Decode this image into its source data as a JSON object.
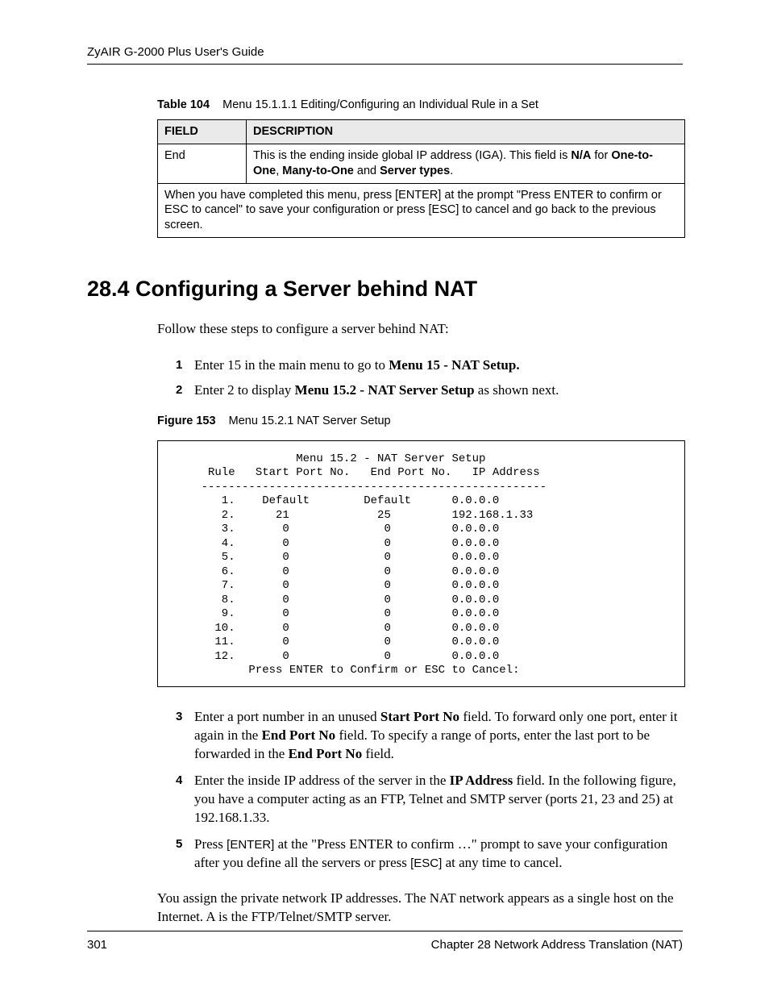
{
  "header": {
    "guide_title": "ZyAIR G-2000 Plus User's Guide"
  },
  "table_caption": {
    "label": "Table 104",
    "text": "Menu 15.1.1.1 Editing/Configuring an Individual Rule in a Set"
  },
  "table": {
    "head_field": "FIELD",
    "head_desc": "DESCRIPTION",
    "row_field": "End",
    "row_desc_pre": "This is the ending inside global IP address (IGA). This field is ",
    "row_desc_b1": "N/A",
    "row_desc_mid": " for ",
    "row_desc_b2": "One-to-One",
    "row_desc_sep": ", ",
    "row_desc_b3": "Many-to-One",
    "row_desc_and": " and ",
    "row_desc_b4": "Server types",
    "row_desc_end": ".",
    "footnote": "When you have completed this menu, press [ENTER] at the prompt \"Press ENTER to confirm or ESC to cancel\" to save your configuration or press [ESC] to cancel and go back to the previous screen."
  },
  "section": {
    "number_title": "28.4  Configuring a Server behind NAT",
    "intro": "Follow these steps to configure a server behind NAT:"
  },
  "steps1": {
    "s1": {
      "n": "1",
      "pre": "Enter 15 in the main menu to go to ",
      "b": "Menu 15 - NAT Setup."
    },
    "s2": {
      "n": "2",
      "pre": "Enter 2 to display ",
      "b": "Menu 15.2 - NAT Server Setup",
      "post": " as shown next."
    }
  },
  "figure_caption": {
    "label": "Figure 153",
    "text": "Menu 15.2.1 NAT Server Setup"
  },
  "menu": {
    "title": "Menu 15.2 - NAT Server Setup",
    "header": "     Rule   Start Port No.   End Port No.   IP Address",
    "divider": "    ---------------------------------------------------",
    "rows": [
      {
        "r": " 1.",
        "s": "Default",
        "e": "Default",
        "ip": "0.0.0.0"
      },
      {
        "r": " 2.",
        "s": "  21",
        "e": "  25",
        "ip": "192.168.1.33"
      },
      {
        "r": " 3.",
        "s": "   0",
        "e": "   0",
        "ip": "0.0.0.0"
      },
      {
        "r": " 4.",
        "s": "   0",
        "e": "   0",
        "ip": "0.0.0.0"
      },
      {
        "r": " 5.",
        "s": "   0",
        "e": "   0",
        "ip": "0.0.0.0"
      },
      {
        "r": " 6.",
        "s": "   0",
        "e": "   0",
        "ip": "0.0.0.0"
      },
      {
        "r": " 7.",
        "s": "   0",
        "e": "   0",
        "ip": "0.0.0.0"
      },
      {
        "r": " 8.",
        "s": "   0",
        "e": "   0",
        "ip": "0.0.0.0"
      },
      {
        "r": " 9.",
        "s": "   0",
        "e": "   0",
        "ip": "0.0.0.0"
      },
      {
        "r": "10.",
        "s": "   0",
        "e": "   0",
        "ip": "0.0.0.0"
      },
      {
        "r": "11.",
        "s": "   0",
        "e": "   0",
        "ip": "0.0.0.0"
      },
      {
        "r": "12.",
        "s": "   0",
        "e": "   0",
        "ip": "0.0.0.0"
      }
    ],
    "prompt": "Press ENTER to Confirm or ESC to Cancel:"
  },
  "steps2": {
    "s3": {
      "n": "3",
      "t1": "Enter a port number in an unused ",
      "b1": "Start Port No",
      "t2": " field. To forward only one port, enter it again in the ",
      "b2": "End Port No",
      "t3": " field. To specify a range of ports, enter the last port to be forwarded in the ",
      "b3": "End Port No",
      "t4": " field."
    },
    "s4": {
      "n": "4",
      "t1": "Enter the inside IP address of the server in the ",
      "b1": "IP Address",
      "t2": " field. In the following figure, you have a computer acting as an FTP, Telnet and SMTP server (ports 21, 23 and 25) at 192.168.1.33."
    },
    "s5": {
      "n": "5",
      "t1": "Press ",
      "k1": "[ENTER]",
      "t2": " at the \"Press ENTER to confirm …\" prompt to save your configuration after you define all the servers or press ",
      "k2": "[ESC]",
      "t3": " at any time to cancel."
    }
  },
  "closing": "You assign the private network IP addresses. The NAT network appears as a single host on the Internet. A is the FTP/Telnet/SMTP server.",
  "footer": {
    "page": "301",
    "chapter": "Chapter 28 Network Address Translation (NAT)"
  }
}
